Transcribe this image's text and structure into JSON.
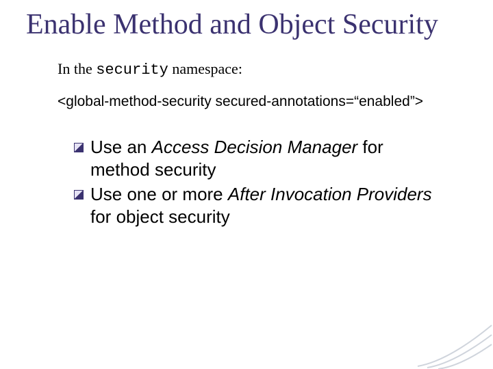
{
  "title": "Enable Method and Object Security",
  "intro": {
    "prefix": "In the ",
    "mono": "security",
    "suffix": " namespace:"
  },
  "code": "<global-method-security secured-annotations=“enabled”>",
  "bullets": [
    {
      "pre": "Use an ",
      "em": "Access Decision Manager",
      "post": " for method security"
    },
    {
      "pre": "Use one or more ",
      "em": "After Invocation Providers",
      "post": " for object security"
    }
  ]
}
